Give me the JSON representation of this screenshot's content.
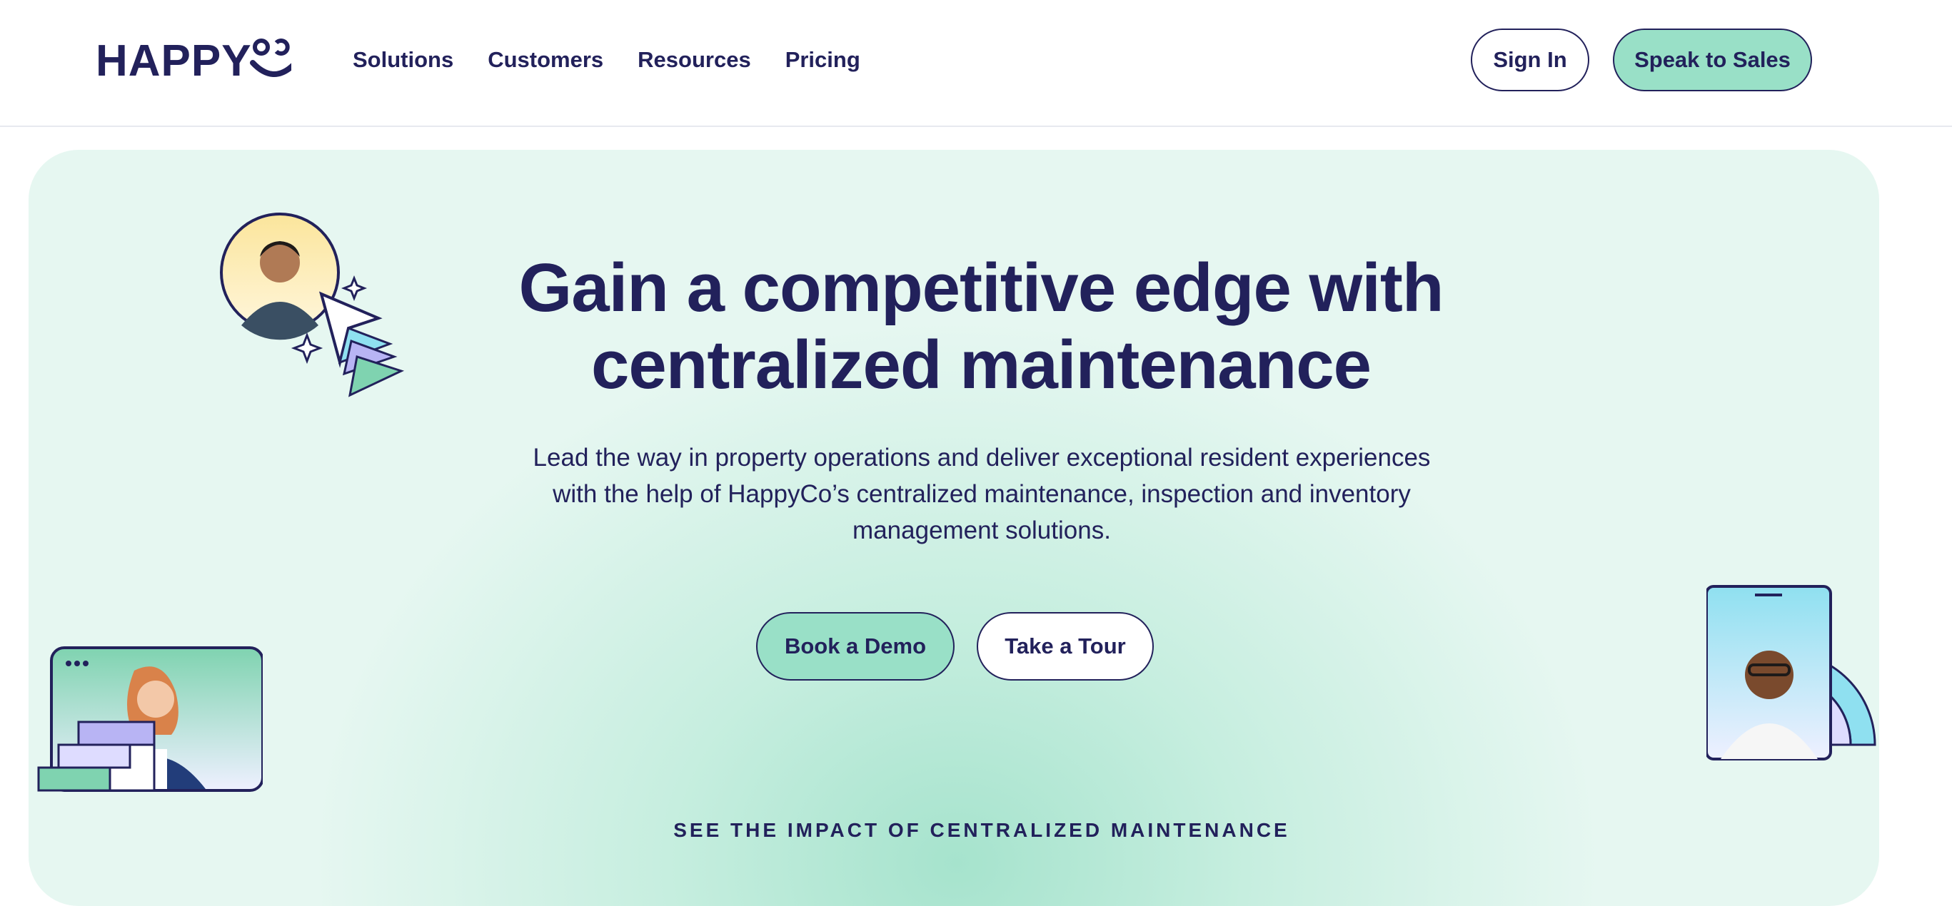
{
  "header": {
    "logo_text": "HAPPYCO",
    "nav": [
      "Solutions",
      "Customers",
      "Resources",
      "Pricing"
    ],
    "sign_in": "Sign In",
    "speak_to_sales": "Speak to Sales"
  },
  "hero": {
    "title": "Gain a competitive edge with centralized maintenance",
    "subtitle": "Lead the way in property operations and deliver exceptional resident experiences with the help of HappyCo’s centralized maintenance, inspection and inventory management solutions.",
    "book_demo": "Book a Demo",
    "take_tour": "Take a Tour",
    "kicker": "SEE THE IMPACT OF CENTRALIZED MAINTENANCE"
  },
  "colors": {
    "navy": "#22215b",
    "mint": "#99e0c7",
    "hero_bg": "#e6f7f1",
    "lavender": "#b8b4f4",
    "sky": "#8fe0f0"
  }
}
